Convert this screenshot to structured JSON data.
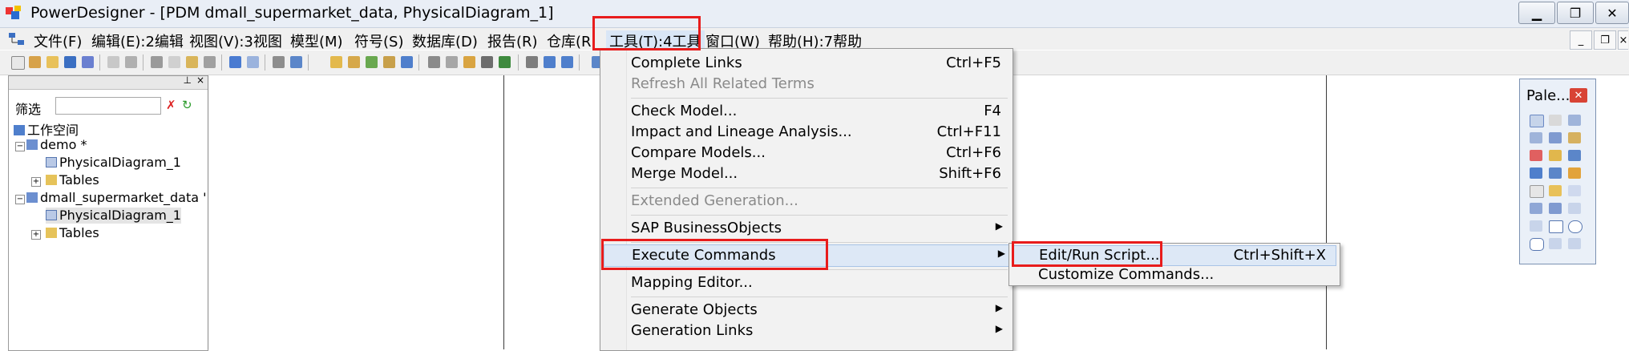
{
  "window": {
    "title": "PowerDesigner - [PDM dmall_supermarket_data, PhysicalDiagram_1]"
  },
  "menubar": {
    "items": [
      "文件(F)",
      "编辑(E):2编辑",
      "视图(V):3视图",
      "模型(M)",
      "符号(S)",
      "数据库(D)",
      "报告(R)",
      "仓库(R",
      "工具(T):4工具",
      "窗口(W)",
      "帮助(H):7帮助"
    ]
  },
  "browser": {
    "filter_label": "筛选",
    "tree": [
      {
        "label": "工作空间"
      },
      {
        "label": "demo *"
      },
      {
        "label": "PhysicalDiagram_1"
      },
      {
        "label": "Tables"
      },
      {
        "label": "dmall_supermarket_data '"
      },
      {
        "label": "PhysicalDiagram_1"
      },
      {
        "label": "Tables"
      }
    ]
  },
  "palette": {
    "title": "Pale..."
  },
  "tools_menu": {
    "items": [
      {
        "label": "Complete Links",
        "shortcut": "Ctrl+F5"
      },
      {
        "label": "Refresh All Related Terms",
        "shortcut": ""
      },
      {
        "label": "Check Model...",
        "shortcut": "F4"
      },
      {
        "label": "Impact and Lineage Analysis...",
        "shortcut": "Ctrl+F11"
      },
      {
        "label": "Compare Models...",
        "shortcut": "Ctrl+F6"
      },
      {
        "label": "Merge Model...",
        "shortcut": "Shift+F6"
      },
      {
        "label": "Extended Generation...",
        "shortcut": ""
      },
      {
        "label": "SAP BusinessObjects",
        "shortcut": ""
      },
      {
        "label": "Execute Commands",
        "shortcut": ""
      },
      {
        "label": "Mapping Editor...",
        "shortcut": ""
      },
      {
        "label": "Generate Objects",
        "shortcut": ""
      },
      {
        "label": "Generation Links",
        "shortcut": ""
      }
    ]
  },
  "execute_submenu": {
    "items": [
      {
        "label": "Edit/Run Script...",
        "shortcut": "Ctrl+Shift+X"
      },
      {
        "label": "Customize Commands...",
        "shortcut": ""
      }
    ]
  },
  "colors": {
    "highlight": "#e81c1c",
    "menu_hover": "#dde8f6"
  }
}
